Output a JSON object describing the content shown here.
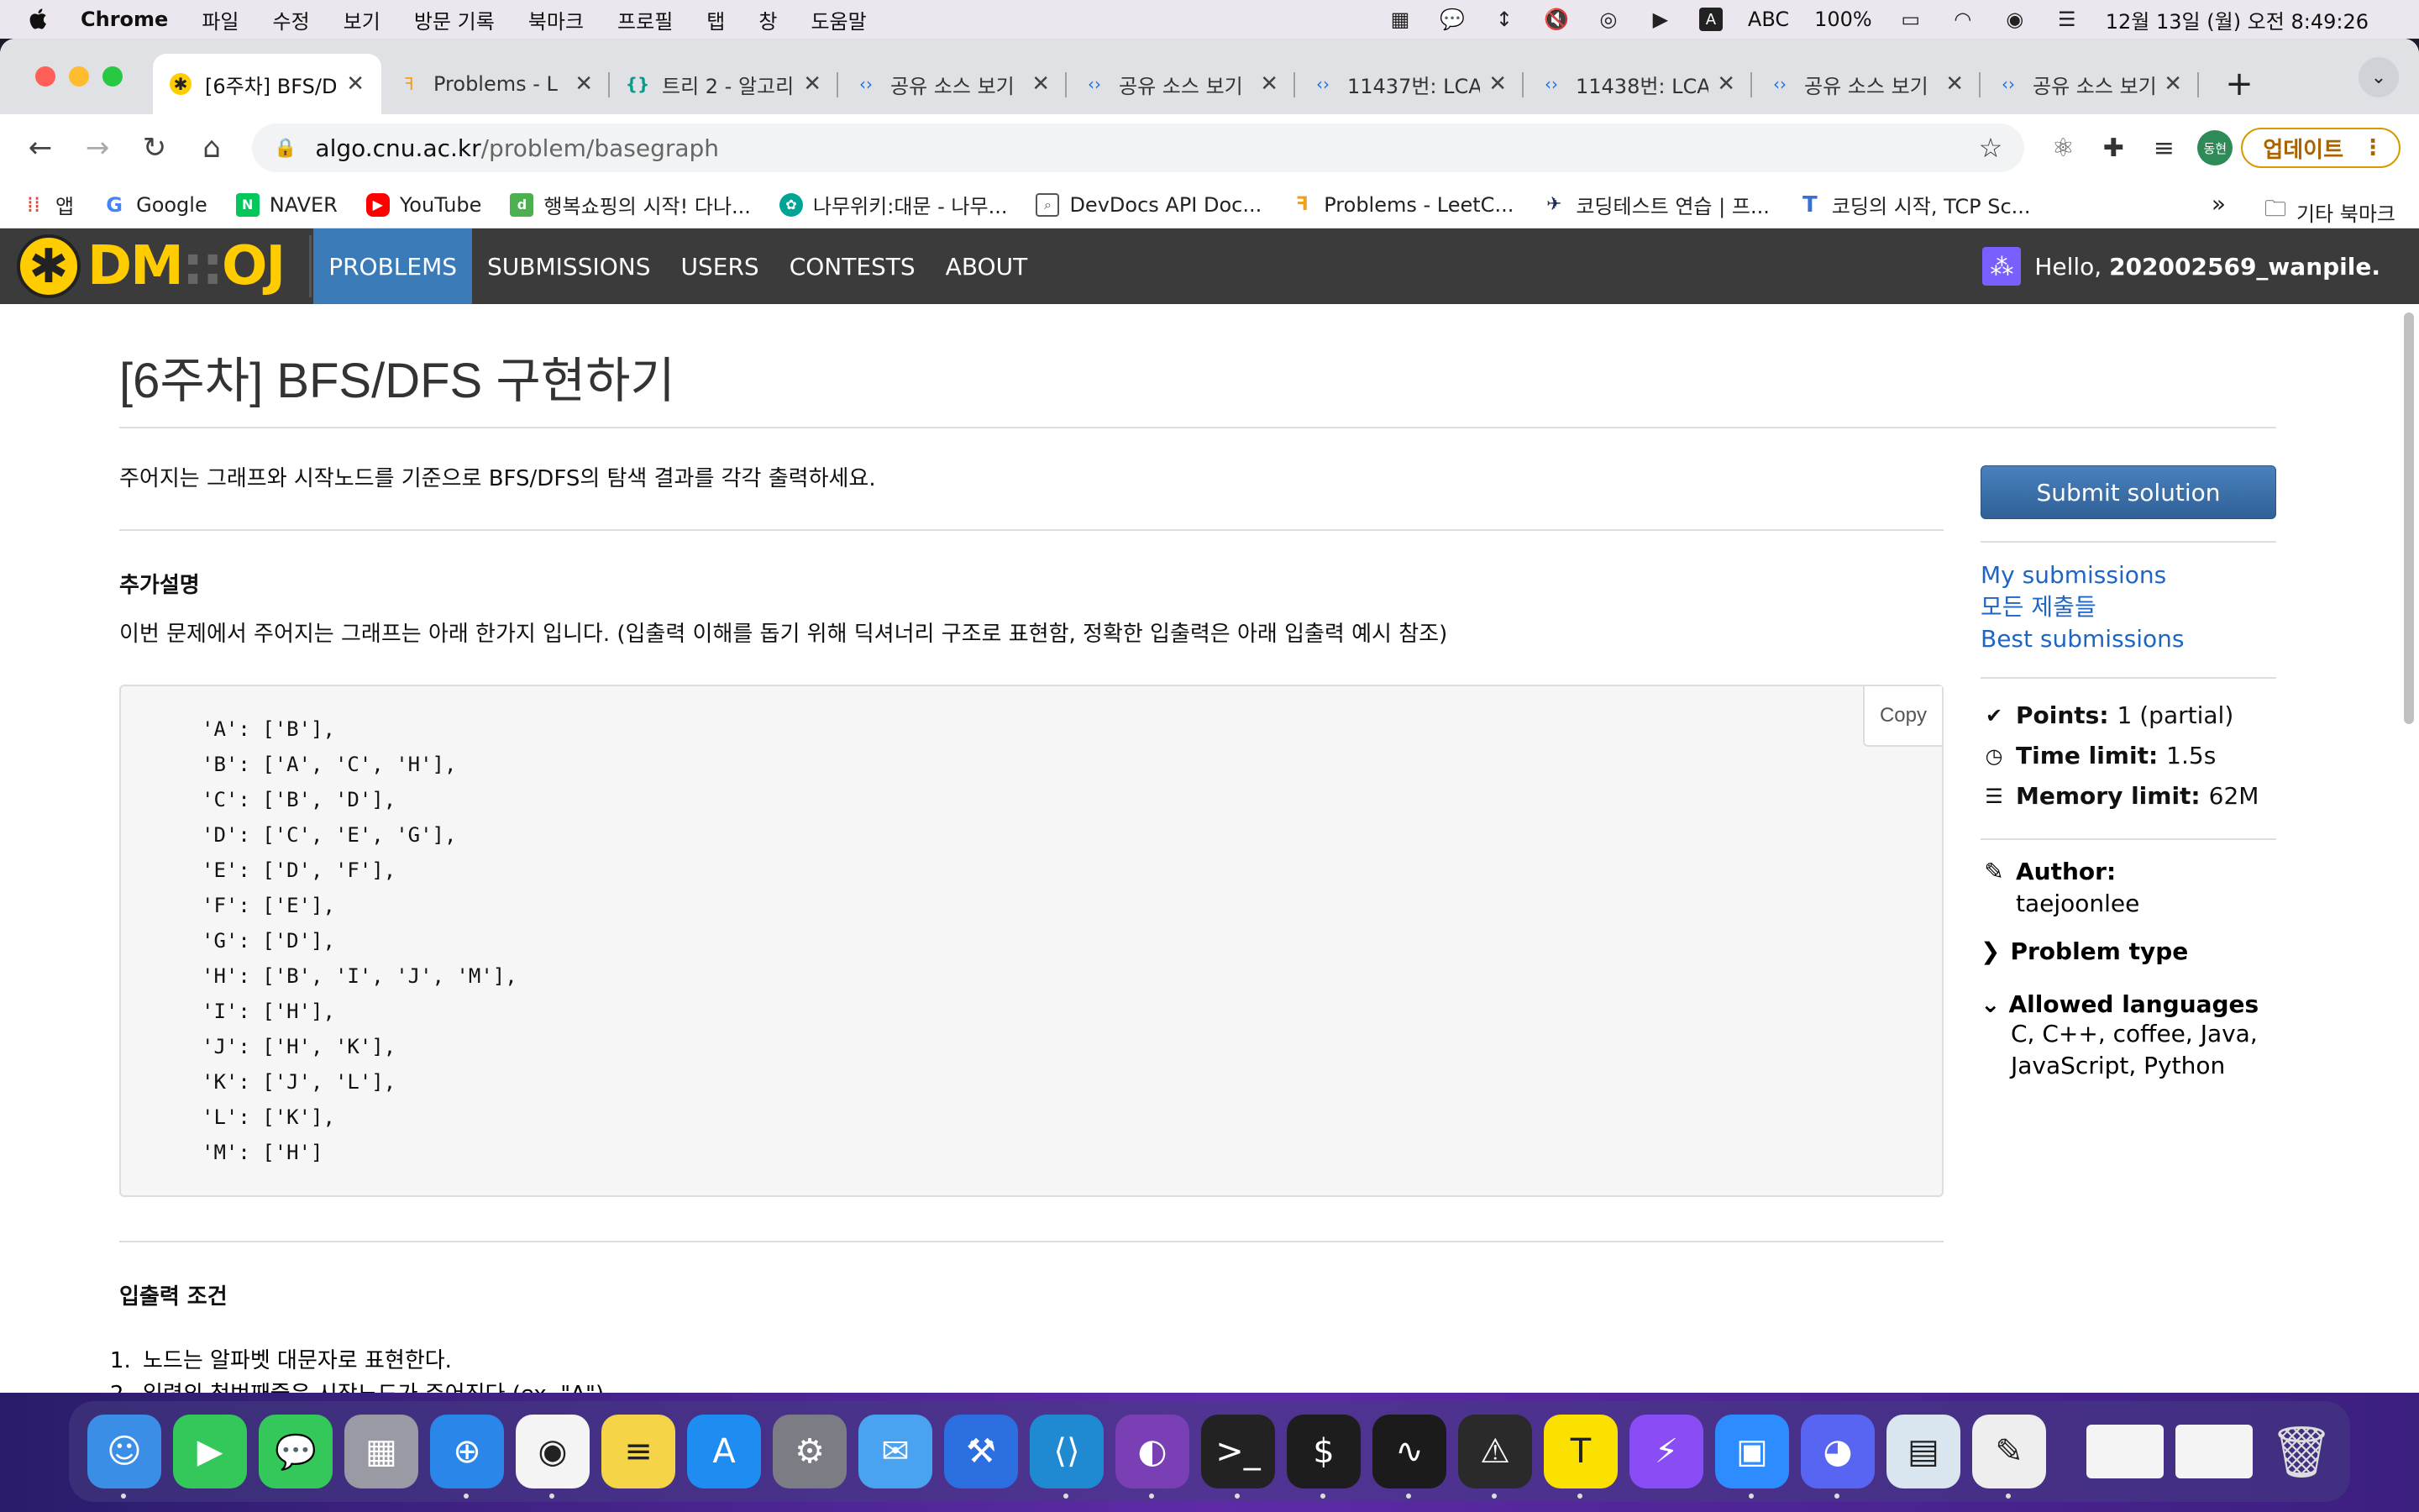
{
  "menubar": {
    "app": "Chrome",
    "items": [
      "파일",
      "수정",
      "보기",
      "방문 기록",
      "북마크",
      "프로필",
      "탭",
      "창",
      "도움말"
    ],
    "input_source": "ABC",
    "battery": "100%",
    "datetime": "12월 13일 (월) 오전 8:49:26"
  },
  "tabs": [
    {
      "title": "[6주차] BFS/D",
      "icon": "dmoj-star-icon",
      "active": true
    },
    {
      "title": "Problems - L",
      "icon": "leetcode-icon",
      "active": false
    },
    {
      "title": "트리 2 - 알고리",
      "icon": "braces-icon",
      "active": false
    },
    {
      "title": "공유 소스 보기",
      "icon": "code-icon",
      "active": false
    },
    {
      "title": "공유 소스 보기",
      "icon": "code-icon",
      "active": false
    },
    {
      "title": "11437번: LCA",
      "icon": "code-icon",
      "active": false
    },
    {
      "title": "11438번: LCA",
      "icon": "code-icon",
      "active": false
    },
    {
      "title": "공유 소스 보기",
      "icon": "code-icon",
      "active": false
    },
    {
      "title": "공유 소스 보기",
      "icon": "code-icon",
      "active": false
    }
  ],
  "omnibox": {
    "host": "algo.cnu.ac.kr",
    "path": "/problem/basegraph"
  },
  "profile_initials": "동현",
  "update_label": "업데이트",
  "bookmarks": [
    {
      "label": "앱",
      "color": "#e04a3f"
    },
    {
      "label": "Google",
      "color": "#4285f4"
    },
    {
      "label": "NAVER",
      "color": "#03c75a"
    },
    {
      "label": "YouTube",
      "color": "#ff0000"
    },
    {
      "label": "행복쇼핑의 시작! 다나...",
      "color": "#4caf50"
    },
    {
      "label": "나무위키:대문 - 나무...",
      "color": "#00a495"
    },
    {
      "label": "DevDocs API Doc...",
      "color": "#555555"
    },
    {
      "label": "Problems - LeetC...",
      "color": "#f0a020"
    },
    {
      "label": "코딩테스트 연습 | 프...",
      "color": "#1b2a5a"
    },
    {
      "label": "코딩의 시작, TCP Sc...",
      "color": "#3a6fd8"
    }
  ],
  "bookmarks_more": "»",
  "bookmarks_other": "기타 북마크",
  "site": {
    "logo_left": "DM",
    "logo_sep": "::",
    "logo_right": "OJ",
    "nav": [
      "PROBLEMS",
      "SUBMISSIONS",
      "USERS",
      "CONTESTS",
      "ABOUT"
    ],
    "hello_prefix": "Hello, ",
    "username": "202002569_wanpile."
  },
  "problem": {
    "title": "[6주차] BFS/DFS 구현하기",
    "lead": "주어지는 그래프와 시작노드를 기준으로 BFS/DFS의 탐색 결과를 각각 출력하세요.",
    "section1_title": "추가설명",
    "section1_text": "이번 문제에서 주어지는 그래프는 아래 한가지 입니다. (입출력 이해를 돕기 위해 딕셔너리 구조로 표현함, 정확한 입출력은 아래 입출력 예시 참조)",
    "code": "'A': ['B'],\n'B': ['A', 'C', 'H'],\n'C': ['B', 'D'],\n'D': ['C', 'E', 'G'],\n'E': ['D', 'F'],\n'F': ['E'],\n'G': ['D'],\n'H': ['B', 'I', 'J', 'M'],\n'I': ['H'],\n'J': ['H', 'K'],\n'K': ['J', 'L'],\n'L': ['K'],\n'M': ['H']",
    "copy_label": "Copy",
    "section2_title": "입출력 조건",
    "conditions": [
      "노드는 알파벳 대문자로 표현한다.",
      "입력의 첫번째줄은 시작노드가 주어진다.(ex. \"A\")"
    ]
  },
  "sidebar": {
    "submit": "Submit solution",
    "links": [
      "My submissions",
      "모든 제출들",
      "Best submissions"
    ],
    "points_label": "Points:",
    "points_value": "1 (partial)",
    "time_label": "Time limit:",
    "time_value": "1.5s",
    "memory_label": "Memory limit:",
    "memory_value": "62M",
    "author_label": "Author:",
    "author_value": "taejoonlee",
    "problem_type_label": "Problem type",
    "languages_label": "Allowed languages",
    "languages_value": "C, C++, coffee, Java, JavaScript, Python"
  },
  "dock": [
    {
      "name": "finder",
      "color": "#3a8ee6"
    },
    {
      "name": "facetime",
      "color": "#34c759"
    },
    {
      "name": "messages",
      "color": "#34c759"
    },
    {
      "name": "launchpad",
      "color": "#9a9aa5"
    },
    {
      "name": "safari",
      "color": "#2a86e8"
    },
    {
      "name": "chrome",
      "color": "#f4f4f4"
    },
    {
      "name": "notes",
      "color": "#f5d547"
    },
    {
      "name": "app-store",
      "color": "#1e8cf0"
    },
    {
      "name": "system-preferences",
      "color": "#7c7c84"
    },
    {
      "name": "mail",
      "color": "#4aa3f0"
    },
    {
      "name": "xcode",
      "color": "#2b6fe0"
    },
    {
      "name": "vscode",
      "color": "#1f8ad2"
    },
    {
      "name": "github-desktop",
      "color": "#7a3fb5"
    },
    {
      "name": "terminal",
      "color": "#222222"
    },
    {
      "name": "iterm",
      "color": "#1d1d1d"
    },
    {
      "name": "activity-monitor",
      "color": "#1b1b1b"
    },
    {
      "name": "console",
      "color": "#2a2a2a"
    },
    {
      "name": "kakaotalk",
      "color": "#fae100"
    },
    {
      "name": "messenger",
      "color": "#8a4cf5"
    },
    {
      "name": "zoom",
      "color": "#2d8cff"
    },
    {
      "name": "discord",
      "color": "#5865f2"
    },
    {
      "name": "preview",
      "color": "#d9e6f0"
    },
    {
      "name": "textedit",
      "color": "#eeeeee"
    }
  ]
}
